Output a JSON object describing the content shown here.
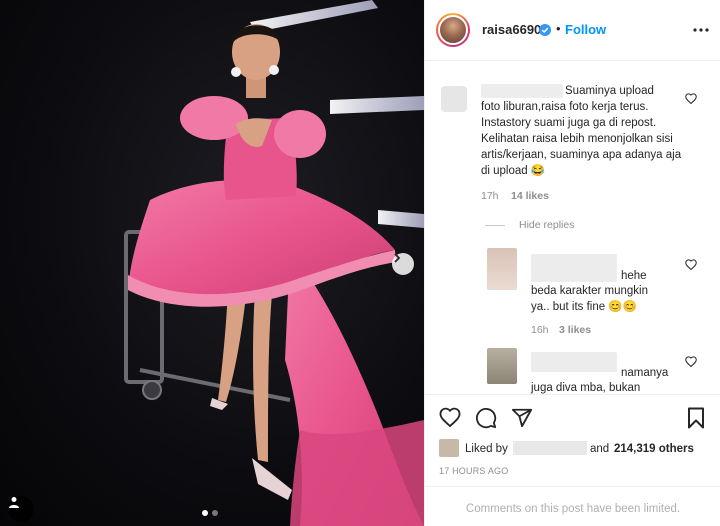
{
  "post": {
    "username": "raisa6690",
    "follow_label": "Follow",
    "bullet": "•",
    "carousel_total": 2,
    "carousel_current": 1
  },
  "comments": [
    {
      "text_line1": "Suaminya upload",
      "text_rest": "foto liburan,raisa foto kerja terus. Instastory suami juga ga di repost. Kelihatan raisa lebih menonjolkan sisi artis/kerjaan, suaminya apa adanya aja di upload 😂",
      "time": "17h",
      "likes": "14 likes",
      "hide_replies": "Hide replies",
      "replies": [
        {
          "text_line1": "hehe",
          "text_rest": "beda karakter mungkin ya.. but its fine 😊😊",
          "time": "16h",
          "likes": "3 likes"
        },
        {
          "text_line1": "namanya",
          "text_rest": "juga diva mba, bukan"
        }
      ]
    }
  ],
  "likes": {
    "liked_by": "Liked by",
    "and": "and",
    "count": "214,319 others"
  },
  "time_ago": "17 HOURS AGO",
  "footer": {
    "limited": "Comments on this post have been limited."
  },
  "colors": {
    "accent": "#0095f6",
    "dress": "#e8548c",
    "muted": "#8e8e8e"
  }
}
